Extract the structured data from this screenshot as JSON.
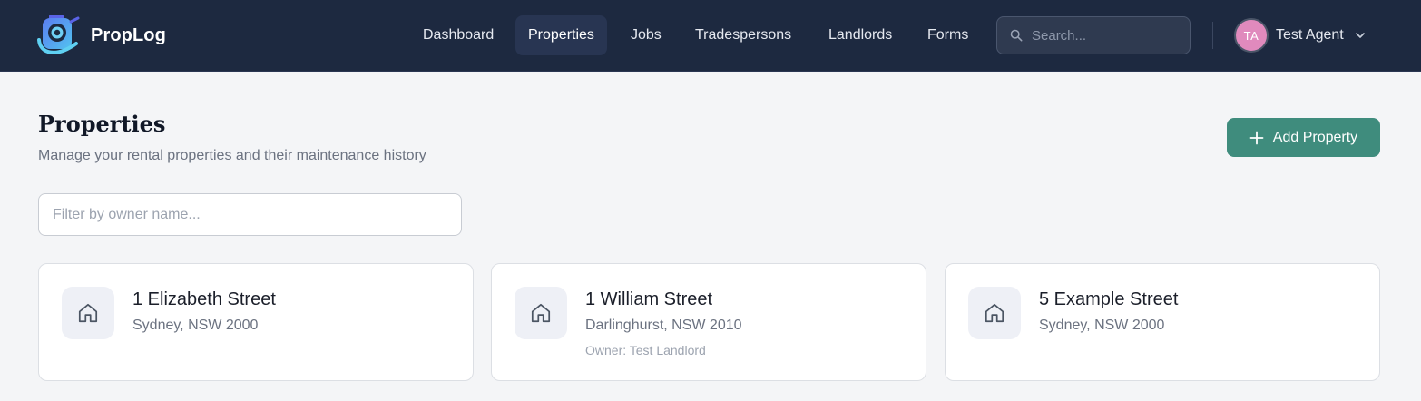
{
  "app": {
    "name": "PropLog"
  },
  "nav": {
    "items": [
      {
        "label": "Dashboard",
        "active": false
      },
      {
        "label": "Properties",
        "active": true
      },
      {
        "label": "Jobs",
        "active": false
      },
      {
        "label": "Tradespersons",
        "active": false
      },
      {
        "label": "Landlords",
        "active": false
      },
      {
        "label": "Forms",
        "active": false
      }
    ]
  },
  "search": {
    "placeholder": "Search...",
    "icon": "search-icon"
  },
  "user": {
    "initials": "TA",
    "name": "Test Agent",
    "avatar_color": "#e08abd"
  },
  "page": {
    "title": "Properties",
    "subtitle": "Manage your rental properties and their maintenance history",
    "add_button_label": "Add Property",
    "filter_placeholder": "Filter by owner name..."
  },
  "properties": [
    {
      "street": "1 Elizabeth Street",
      "location": "Sydney, NSW 2000",
      "owner": ""
    },
    {
      "street": "1 William Street",
      "location": "Darlinghurst, NSW 2010",
      "owner": "Owner: Test Landlord"
    },
    {
      "street": "5 Example Street",
      "location": "Sydney, NSW 2000",
      "owner": ""
    }
  ],
  "colors": {
    "topbar": "#1d2940",
    "accent": "#3f8c7d",
    "page_bg": "#f4f5f7"
  }
}
